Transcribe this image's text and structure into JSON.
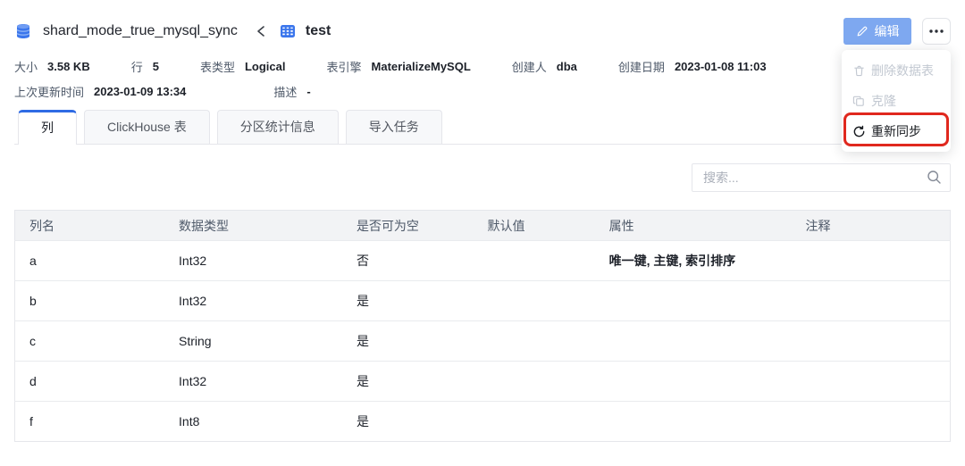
{
  "header": {
    "database_name": "shard_mode_true_mysql_sync",
    "table_title": "test"
  },
  "actions": {
    "edit_label": "编辑"
  },
  "menu": {
    "items": [
      {
        "label": "删除数据表",
        "icon": "delete-icon",
        "disabled": true
      },
      {
        "label": "克隆",
        "icon": "clone-icon",
        "disabled": true
      },
      {
        "label": "重新同步",
        "icon": "resync-icon",
        "disabled": false,
        "highlighted": true
      }
    ]
  },
  "icons": {
    "database-icon": "blue cylinder",
    "table-icon": "blue grid",
    "breadcrumb-back-icon": "‹",
    "edit-icon": "✎",
    "more-icon": "⋯",
    "delete-icon": "🗑",
    "clone-icon": "⧉",
    "resync-icon": "↻",
    "search-icon": "🔍"
  },
  "meta": {
    "rows": [
      [
        {
          "label": "大小",
          "value": "3.58 KB"
        },
        {
          "label": "行",
          "value": "5"
        },
        {
          "label": "表类型",
          "value": "Logical"
        },
        {
          "label": "表引擎",
          "value": "MaterializeMySQL"
        },
        {
          "label": "创建人",
          "value": "dba"
        },
        {
          "label": "创建日期",
          "value": "2023-01-08 11:03"
        }
      ],
      [
        {
          "label": "上次更新时间",
          "value": "2023-01-09 13:34"
        },
        {
          "label": "描述",
          "value": "-"
        }
      ]
    ]
  },
  "tabs": {
    "items": [
      {
        "label": "列",
        "active": true
      },
      {
        "label": "ClickHouse 表",
        "active": false
      },
      {
        "label": "分区统计信息",
        "active": false
      },
      {
        "label": "导入任务",
        "active": false
      }
    ]
  },
  "search": {
    "placeholder": "搜索..."
  },
  "columns_table": {
    "headers": [
      "列名",
      "数据类型",
      "是否可为空",
      "默认值",
      "属性",
      "注释"
    ],
    "rows": [
      [
        "a",
        "Int32",
        "否",
        "",
        "唯一键, 主键, 索引排序",
        ""
      ],
      [
        "b",
        "Int32",
        "是",
        "",
        "",
        ""
      ],
      [
        "c",
        "String",
        "是",
        "",
        "",
        ""
      ],
      [
        "d",
        "Int32",
        "是",
        "",
        "",
        ""
      ],
      [
        "f",
        "Int8",
        "是",
        "",
        "",
        ""
      ]
    ]
  },
  "colors": {
    "primary_blue": "#3370eb",
    "tab_active_border": "#2f6be4",
    "edit_button": "#7ea8f0",
    "annotation_red": "#e0281e",
    "text_dark": "#1d2129",
    "text_gray": "#4e5969",
    "disabled_gray": "#c2c8d1",
    "border": "#e5e6eb",
    "table_header_bg": "#f2f3f5"
  }
}
